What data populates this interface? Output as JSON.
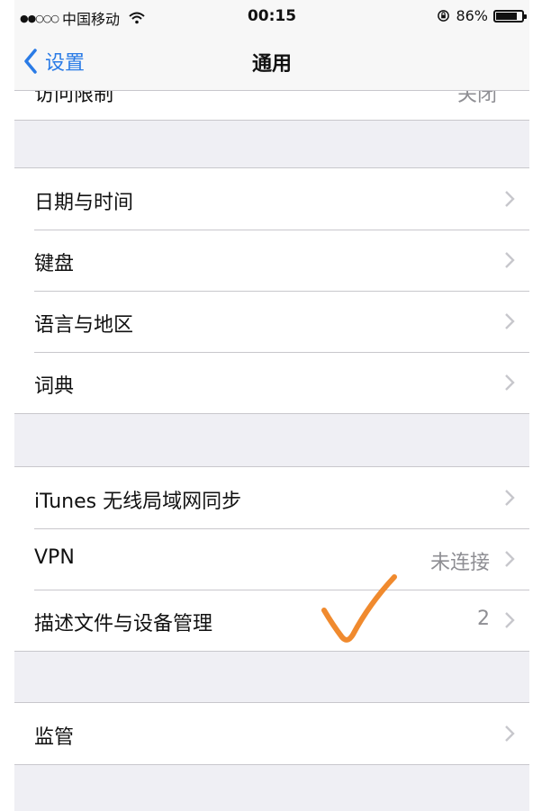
{
  "status_bar": {
    "signal": "●●○○○",
    "carrier": "中国移动",
    "time": "00:15",
    "battery_percent": "86%",
    "battery_level": 0.86
  },
  "nav": {
    "back_label": "设置",
    "title": "通用"
  },
  "partial_row": {
    "label": "访问限制",
    "value": "关闭"
  },
  "groups": [
    {
      "rows": [
        {
          "label": "日期与时间",
          "value": ""
        },
        {
          "label": "键盘",
          "value": ""
        },
        {
          "label": "语言与地区",
          "value": ""
        },
        {
          "label": "词典",
          "value": ""
        }
      ]
    },
    {
      "rows": [
        {
          "label": "iTunes 无线局域网同步",
          "value": ""
        },
        {
          "label": "VPN",
          "value": "未连接"
        },
        {
          "label": "描述文件与设备管理",
          "value": "2"
        }
      ]
    },
    {
      "rows": [
        {
          "label": "监管",
          "value": ""
        }
      ]
    }
  ],
  "annotation": {
    "icon": "checkmark-icon",
    "color": "#f08a2e"
  },
  "colors": {
    "accent": "#2a7be6",
    "background": "#efeff4"
  }
}
